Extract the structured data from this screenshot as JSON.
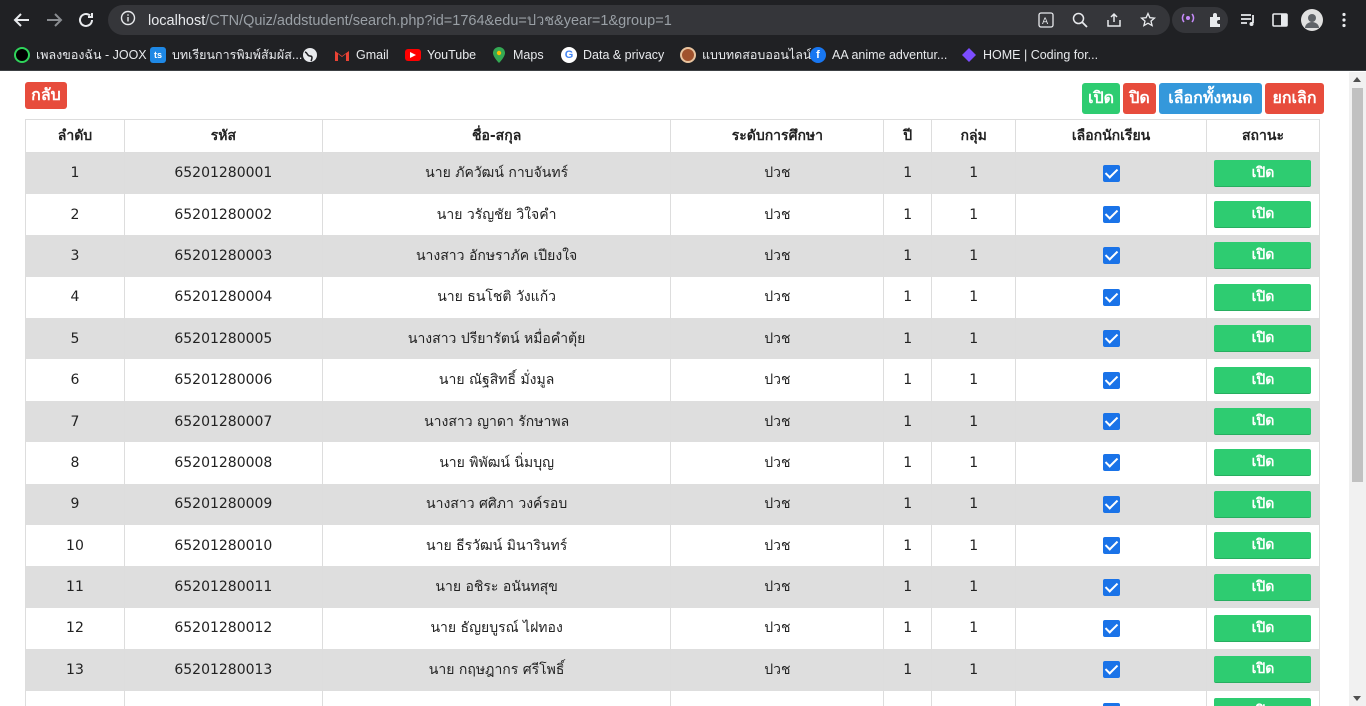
{
  "browser": {
    "url_host": "localhost",
    "url_path": "/CTN/Quiz/addstudent/search.php?id=1764&edu=ปวช&year=1&group=1"
  },
  "bookmarks": [
    {
      "label": "เพลงของฉัน - JOOX",
      "icon": "joox-icon",
      "color": "#000000"
    },
    {
      "label": "บทเรียนการพิมพ์สัมผัส...",
      "icon": "ts-icon",
      "color": "#1e88e5"
    },
    {
      "label": "",
      "icon": "globe-icon",
      "color": "#5f6368"
    },
    {
      "label": "Gmail",
      "icon": "gmail-icon",
      "color": "#ea4335"
    },
    {
      "label": "YouTube",
      "icon": "youtube-icon",
      "color": "#ff0000"
    },
    {
      "label": "Maps",
      "icon": "maps-icon",
      "color": "#34a853"
    },
    {
      "label": "Data & privacy",
      "icon": "google-icon",
      "color": "#4285f4"
    },
    {
      "label": "แบบทดสอบออนไลน์",
      "icon": "quiz-icon",
      "color": "#a0522d"
    },
    {
      "label": "AA anime adventur...",
      "icon": "facebook-icon",
      "color": "#1877f2"
    },
    {
      "label": "HOME | Coding for...",
      "icon": "coding-icon",
      "color": "#7c4dff"
    }
  ],
  "buttons": {
    "back": "กลับ",
    "open": "เปิด",
    "close": "ปิด",
    "select_all": "เลือกทั้งหมด",
    "cancel": "ยกเลิก"
  },
  "colors": {
    "red": "#e74c3c",
    "green": "#2ecc71",
    "blue": "#3498db"
  },
  "table": {
    "headers": [
      "ลำดับ",
      "รหัส",
      "ชื่อ-สกุล",
      "ระดับการศึกษา",
      "ปี",
      "กลุ่ม",
      "เลือกนักเรียน",
      "สถานะ"
    ],
    "rows": [
      {
        "no": "1",
        "id": "65201280001",
        "name": "นาย ภัควัฒน์ กาบจันทร์",
        "level": "ปวช",
        "year": "1",
        "group": "1",
        "checked": true,
        "status": "เปิด"
      },
      {
        "no": "2",
        "id": "65201280002",
        "name": "นาย วรัญชัย วิใจคำ",
        "level": "ปวช",
        "year": "1",
        "group": "1",
        "checked": true,
        "status": "เปิด"
      },
      {
        "no": "3",
        "id": "65201280003",
        "name": "นางสาว อักษราภัค เปียงใจ",
        "level": "ปวช",
        "year": "1",
        "group": "1",
        "checked": true,
        "status": "เปิด"
      },
      {
        "no": "4",
        "id": "65201280004",
        "name": "นาย ธนโชติ วังแก้ว",
        "level": "ปวช",
        "year": "1",
        "group": "1",
        "checked": true,
        "status": "เปิด"
      },
      {
        "no": "5",
        "id": "65201280005",
        "name": "นางสาว ปรียารัตน์ หมื่อคำตุ้ย",
        "level": "ปวช",
        "year": "1",
        "group": "1",
        "checked": true,
        "status": "เปิด"
      },
      {
        "no": "6",
        "id": "65201280006",
        "name": "นาย ณัฐสิทธิ์ มั่งมูล",
        "level": "ปวช",
        "year": "1",
        "group": "1",
        "checked": true,
        "status": "เปิด"
      },
      {
        "no": "7",
        "id": "65201280007",
        "name": "นางสาว ญาดา รักษาพล",
        "level": "ปวช",
        "year": "1",
        "group": "1",
        "checked": true,
        "status": "เปิด"
      },
      {
        "no": "8",
        "id": "65201280008",
        "name": "นาย พิพัฒน์ นิ่มบุญ",
        "level": "ปวช",
        "year": "1",
        "group": "1",
        "checked": true,
        "status": "เปิด"
      },
      {
        "no": "9",
        "id": "65201280009",
        "name": "นางสาว ศศิภา วงค์รอบ",
        "level": "ปวช",
        "year": "1",
        "group": "1",
        "checked": true,
        "status": "เปิด"
      },
      {
        "no": "10",
        "id": "65201280010",
        "name": "นาย ธีรวัฒน์ มินารินทร์",
        "level": "ปวช",
        "year": "1",
        "group": "1",
        "checked": true,
        "status": "เปิด"
      },
      {
        "no": "11",
        "id": "65201280011",
        "name": "นาย อชิระ อนันทสุข",
        "level": "ปวช",
        "year": "1",
        "group": "1",
        "checked": true,
        "status": "เปิด"
      },
      {
        "no": "12",
        "id": "65201280012",
        "name": "นาย ธัญยบูรณ์ ไฝทอง",
        "level": "ปวช",
        "year": "1",
        "group": "1",
        "checked": true,
        "status": "เปิด"
      },
      {
        "no": "13",
        "id": "65201280013",
        "name": "นาย กฤษฎากร ศรีโพธิ์",
        "level": "ปวช",
        "year": "1",
        "group": "1",
        "checked": true,
        "status": "เปิด"
      },
      {
        "no": "",
        "id": "",
        "name": "",
        "level": "",
        "year": "",
        "group": "",
        "checked": true,
        "status": "เปิด"
      }
    ]
  }
}
